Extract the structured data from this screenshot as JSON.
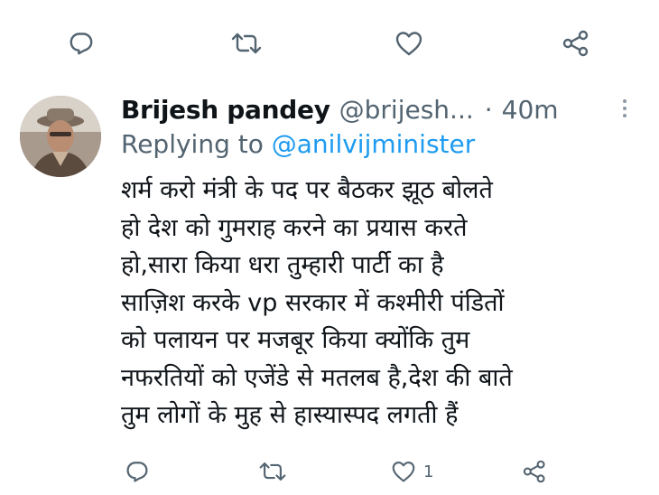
{
  "top_actions": {
    "reply_icon": "reply-icon",
    "retweet_icon": "retweet-icon",
    "like_icon": "heart-icon",
    "share_icon": "share-icon"
  },
  "tweet": {
    "avatar_icon": "avatar",
    "display_name": "Brijesh pandey",
    "handle": "@brijesh...",
    "separator": "·",
    "time": "40m",
    "replying_prefix": "Replying to",
    "replying_to": "@anilvijminister",
    "lines": [
      "शर्म करो मंत्री के पद पर बैठकर झूठ बोलते",
      "हो देश को गुमराह करने का प्रयास करते",
      "हो,सारा किया धरा तुम्हारी पार्टी का है",
      "साज़िश करके vp सरकार में कश्मीरी पंडितों",
      "को पलायन पर मजबूर किया क्योंकि तुम",
      "नफरतियों को एजेंडे से मतलब है,देश की बाते",
      "तुम लोगों के मुह से हास्यास्पद लगती हैं"
    ]
  },
  "bottom_actions": {
    "like_count": "1"
  },
  "colors": {
    "text": "#0f1419",
    "secondary": "#536471",
    "link": "#1d9bf0",
    "background": "#ffffff"
  }
}
